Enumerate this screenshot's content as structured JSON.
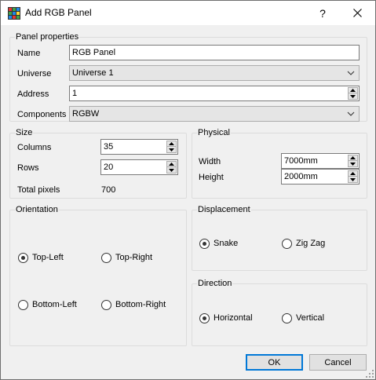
{
  "window": {
    "title": "Add RGB Panel",
    "help_glyph": "?",
    "icons": {
      "app": "rgb-panel-icon",
      "close": "close-icon"
    }
  },
  "panel_properties": {
    "title": "Panel properties",
    "name_label": "Name",
    "name_value": "RGB Panel",
    "universe_label": "Universe",
    "universe_value": "Universe 1",
    "address_label": "Address",
    "address_value": "1",
    "components_label": "Components",
    "components_value": "RGBW"
  },
  "size": {
    "title": "Size",
    "columns_label": "Columns",
    "columns_value": "35",
    "rows_label": "Rows",
    "rows_value": "20",
    "total_label": "Total pixels",
    "total_value": "700"
  },
  "physical": {
    "title": "Physical",
    "width_label": "Width",
    "width_value": "7000mm",
    "height_label": "Height",
    "height_value": "2000mm"
  },
  "orientation": {
    "title": "Orientation",
    "options": [
      "Top-Left",
      "Top-Right",
      "Bottom-Left",
      "Bottom-Right"
    ],
    "selected": "Top-Left"
  },
  "displacement": {
    "title": "Displacement",
    "options": [
      "Snake",
      "Zig Zag"
    ],
    "selected": "Snake"
  },
  "direction": {
    "title": "Direction",
    "options": [
      "Horizontal",
      "Vertical"
    ],
    "selected": "Horizontal"
  },
  "buttons": {
    "ok": "OK",
    "cancel": "Cancel"
  },
  "colors": {
    "accent": "#0078d7",
    "background": "#f0f0f0",
    "field_border": "#7a7a7a"
  }
}
